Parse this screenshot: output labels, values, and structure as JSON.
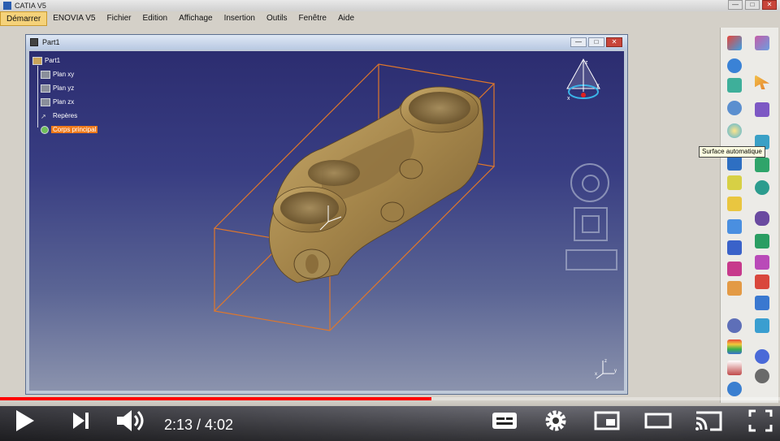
{
  "app": {
    "title": "CATIA V5",
    "window_controls": [
      "—",
      "□",
      "✕"
    ]
  },
  "menubar": {
    "items": [
      {
        "label": "Démarrer",
        "active": true
      },
      {
        "label": "ENOVIA V5",
        "active": false
      },
      {
        "label": "Fichier",
        "active": false
      },
      {
        "label": "Edition",
        "active": false
      },
      {
        "label": "Affichage",
        "active": false
      },
      {
        "label": "Insertion",
        "active": false
      },
      {
        "label": "Outils",
        "active": false
      },
      {
        "label": "Fenêtre",
        "active": false
      },
      {
        "label": "Aide",
        "active": false
      }
    ]
  },
  "document": {
    "title": "Part1",
    "controls": [
      "—",
      "□",
      "✕"
    ]
  },
  "tree": {
    "root": "Part1",
    "plane_xy": "Plan xy",
    "plane_yz": "Plan yz",
    "plane_zx": "Plan zx",
    "axes": "Repères",
    "body": "Corps principal"
  },
  "compass": {
    "z": "z",
    "y": "y",
    "x": "x"
  },
  "viewport_axes": {
    "x": "x",
    "y": "y",
    "z": "z"
  },
  "tooltip": {
    "text": "Surface automatique"
  },
  "player": {
    "current_time": "2:13",
    "duration": "4:02",
    "time_text": "2:13 / 4:02",
    "progress": 0.553
  },
  "colors": {
    "selected_node": "#f07a1a",
    "part_bronze": "#a8894f",
    "bounding_box": "#e0772a",
    "progress_red": "#ff0000"
  }
}
